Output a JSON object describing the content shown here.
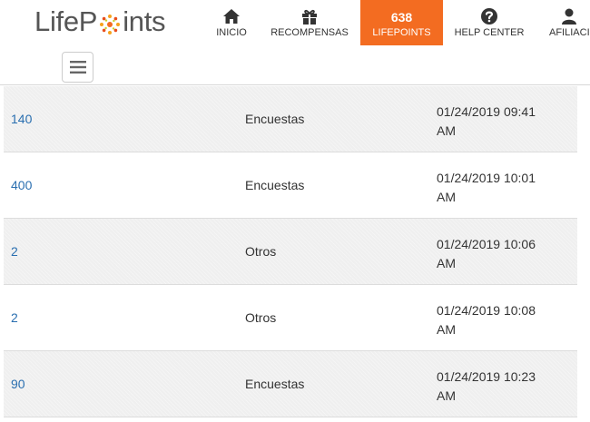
{
  "brand": {
    "logo_part1": "Life",
    "logo_part2": "P",
    "logo_part3": "ints",
    "accent": "#f36c21"
  },
  "nav": {
    "home": "INICIO",
    "rewards": "RECOMPENSAS",
    "points_count": "638",
    "points_label": "LIFEPOINTS",
    "help": "HELP CENTER",
    "account": "AFILIACI"
  },
  "menu_button_icon": "hamburger-icon",
  "transactions": [
    {
      "points": "140",
      "category": "Encuestas",
      "date_line1": "01/24/2019 09:41",
      "date_line2": "AM"
    },
    {
      "points": "400",
      "category": "Encuestas",
      "date_line1": "01/24/2019 10:01",
      "date_line2": "AM"
    },
    {
      "points": "2",
      "category": "Otros",
      "date_line1": "01/24/2019 10:06",
      "date_line2": "AM"
    },
    {
      "points": "2",
      "category": "Otros",
      "date_line1": "01/24/2019 10:08",
      "date_line2": "AM"
    },
    {
      "points": "90",
      "category": "Encuestas",
      "date_line1": "01/24/2019 10:23",
      "date_line2": "AM"
    }
  ]
}
